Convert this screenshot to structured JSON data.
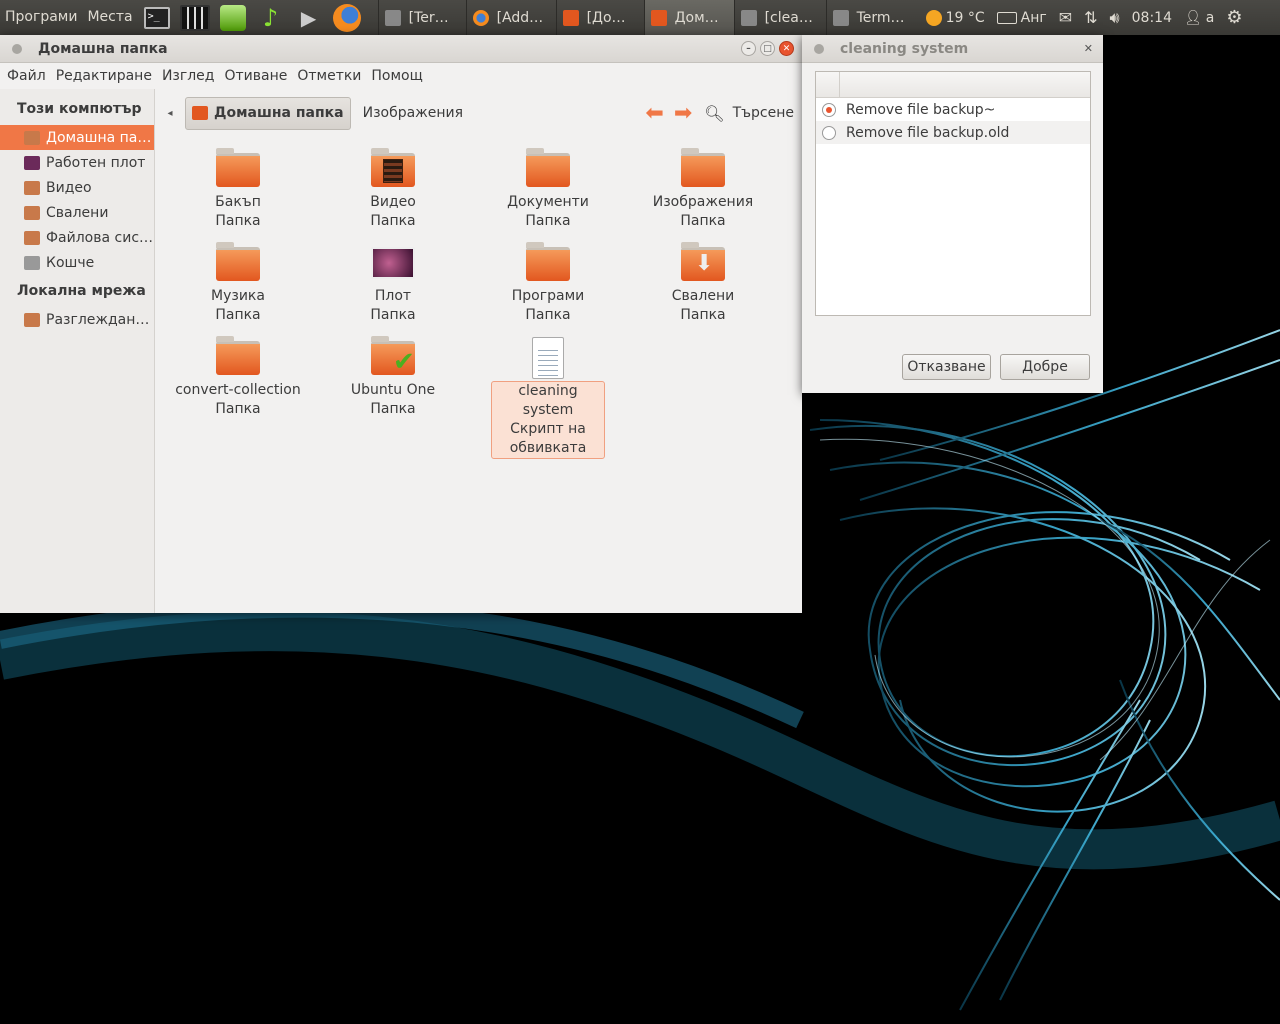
{
  "panel": {
    "apps_menu": "Програми",
    "places_menu": "Места",
    "launchers": [
      "terminal-icon",
      "movie-maker-icon",
      "software-center-icon",
      "music-icon",
      "media-player-icon",
      "firefox-icon"
    ],
    "tasks": [
      {
        "label": "[Ter…",
        "icon": "image-icon"
      },
      {
        "label": "[Add…",
        "icon": "firefox-icon"
      },
      {
        "label": "[До…",
        "icon": "folder-icon"
      },
      {
        "label": "Дом…",
        "icon": "folder-icon",
        "active": true
      },
      {
        "label": "[clea…",
        "icon": "text-editor-icon"
      },
      {
        "label": "Term…",
        "icon": "terminal-icon"
      }
    ],
    "weather": "19 °C",
    "keyboard_layout": "Анг",
    "clock": "08:14",
    "user": "a"
  },
  "nautilus": {
    "title": "Домашна папка",
    "menu": [
      "Файл",
      "Редактиране",
      "Изглед",
      "Отиване",
      "Отметки",
      "Помощ"
    ],
    "sidebar": {
      "computer_header": "Този компютър",
      "computer_items": [
        {
          "label": "Домашна па…",
          "icon": "home-folder-icon",
          "selected": true
        },
        {
          "label": "Работен плот",
          "icon": "desktop-icon"
        },
        {
          "label": "Видео",
          "icon": "video-icon"
        },
        {
          "label": "Свалени",
          "icon": "downloads-icon"
        },
        {
          "label": "Файлова сис…",
          "icon": "filesystem-icon"
        },
        {
          "label": "Кошче",
          "icon": "trash-icon"
        }
      ],
      "network_header": "Локална мрежа",
      "network_items": [
        {
          "label": "Разглеждан…",
          "icon": "network-icon"
        }
      ]
    },
    "toolbar": {
      "crumb_current": "Домашна папка",
      "crumb_next": "Изображения",
      "search_label": "Търсене"
    },
    "items": [
      {
        "name": "Бакъп",
        "type": "Папка",
        "icon": "folder-icon"
      },
      {
        "name": "Видео",
        "type": "Папка",
        "icon": "video-folder-icon"
      },
      {
        "name": "Документи",
        "type": "Папка",
        "icon": "folder-icon"
      },
      {
        "name": "Изображения",
        "type": "Папка",
        "icon": "folder-icon"
      },
      {
        "name": "Музика",
        "type": "Папка",
        "icon": "folder-icon"
      },
      {
        "name": "Плот",
        "type": "Папка",
        "icon": "desktop-folder-icon"
      },
      {
        "name": "Програми",
        "type": "Папка",
        "icon": "folder-icon"
      },
      {
        "name": "Свалени",
        "type": "Папка",
        "icon": "downloads-folder-icon"
      },
      {
        "name": "convert-collection",
        "type": "Папка",
        "icon": "folder-icon"
      },
      {
        "name": "Ubuntu One",
        "type": "Папка",
        "icon": "ubuntu-one-folder-icon"
      },
      {
        "name": "cleaning system",
        "type": "Скрипт на обвивката",
        "icon": "script-file-icon",
        "selected": true
      }
    ]
  },
  "dialog": {
    "title": "cleaning system",
    "options": [
      {
        "label": "Remove file backup~",
        "checked": true
      },
      {
        "label": "Remove file backup.old",
        "checked": false
      }
    ],
    "cancel_label": "Отказване",
    "ok_label": "Добре"
  },
  "colors": {
    "accent": "#f07746",
    "panel": "#3c3b37",
    "wallpaper_swirl": "#5ec8e8"
  }
}
